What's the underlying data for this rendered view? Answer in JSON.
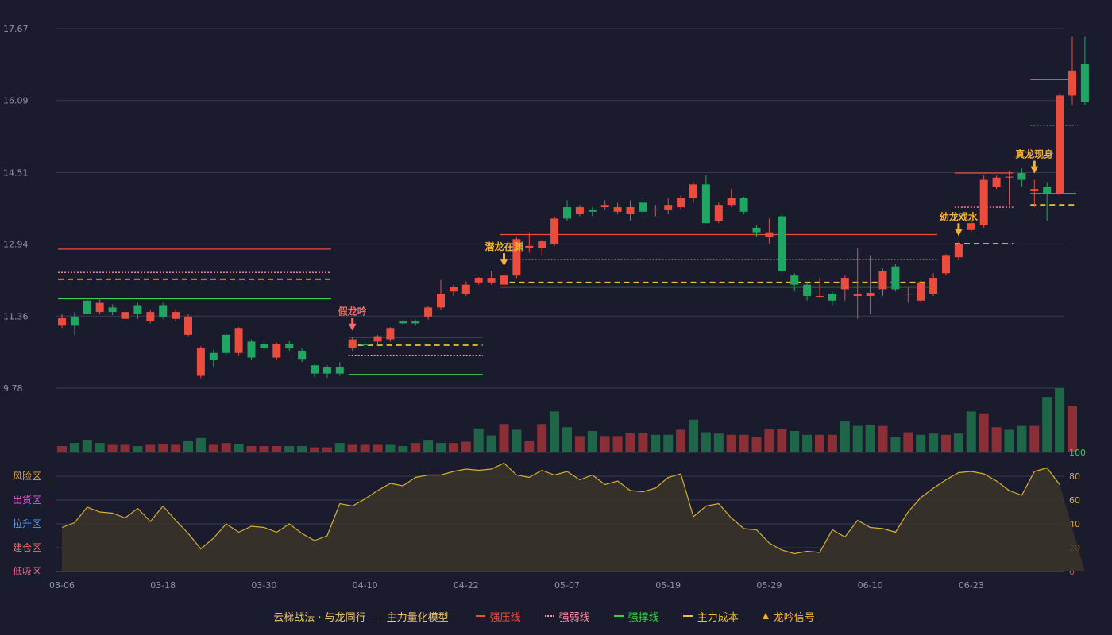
{
  "chart_data": {
    "type": "candlestick",
    "title": "云梯战法 · 与龙同行——主力量化模型",
    "price_axis": {
      "ticks": [
        9.78,
        11.36,
        12.94,
        14.51,
        16.09,
        17.67
      ],
      "range": [
        9.78,
        17.67
      ]
    },
    "date_labels": [
      {
        "i": 0,
        "label": "03-06"
      },
      {
        "i": 8,
        "label": "03-18"
      },
      {
        "i": 16,
        "label": "03-30"
      },
      {
        "i": 24,
        "label": "04-10"
      },
      {
        "i": 32,
        "label": "04-22"
      },
      {
        "i": 40,
        "label": "05-07"
      },
      {
        "i": 48,
        "label": "05-19"
      },
      {
        "i": 56,
        "label": "05-29"
      },
      {
        "i": 64,
        "label": "06-10"
      },
      {
        "i": 72,
        "label": "06-23"
      }
    ],
    "candles": [
      [
        11.15,
        11.32,
        11.4,
        11.1
      ],
      [
        11.35,
        11.15,
        11.45,
        10.95
      ],
      [
        11.7,
        11.4,
        11.72,
        11.4
      ],
      [
        11.45,
        11.65,
        11.75,
        11.4
      ],
      [
        11.55,
        11.45,
        11.62,
        11.38
      ],
      [
        11.3,
        11.45,
        11.55,
        11.25
      ],
      [
        11.6,
        11.4,
        11.65,
        11.3
      ],
      [
        11.25,
        11.45,
        11.5,
        11.2
      ],
      [
        11.6,
        11.35,
        11.65,
        11.3
      ],
      [
        11.3,
        11.45,
        11.52,
        11.25
      ],
      [
        10.95,
        11.35,
        11.4,
        10.92
      ],
      [
        10.05,
        10.65,
        10.7,
        10.0
      ],
      [
        10.55,
        10.4,
        10.62,
        10.25
      ],
      [
        10.95,
        10.55,
        10.98,
        10.5
      ],
      [
        10.55,
        11.1,
        11.12,
        10.5
      ],
      [
        10.8,
        10.45,
        10.85,
        10.4
      ],
      [
        10.75,
        10.65,
        10.8,
        10.6
      ],
      [
        10.45,
        10.75,
        10.78,
        10.4
      ],
      [
        10.75,
        10.65,
        10.82,
        10.6
      ],
      [
        10.6,
        10.42,
        10.65,
        10.35
      ],
      [
        10.28,
        10.1,
        10.32,
        10.02
      ],
      [
        10.25,
        10.1,
        10.28,
        10.0
      ],
      [
        10.25,
        10.1,
        10.35,
        10.05
      ],
      [
        10.65,
        10.85,
        10.9,
        10.6
      ],
      [
        10.75,
        10.72,
        10.78,
        10.65
      ],
      [
        10.8,
        10.92,
        10.95,
        10.72
      ],
      [
        10.85,
        11.1,
        11.12,
        10.8
      ],
      [
        11.25,
        11.2,
        11.3,
        11.15
      ],
      [
        11.25,
        11.2,
        11.28,
        11.15
      ],
      [
        11.35,
        11.55,
        11.58,
        11.28
      ],
      [
        11.55,
        11.85,
        12.15,
        11.5
      ],
      [
        11.9,
        12.0,
        12.05,
        11.8
      ],
      [
        11.85,
        12.05,
        12.12,
        11.8
      ],
      [
        12.1,
        12.2,
        12.22,
        12.05
      ],
      [
        12.1,
        12.2,
        12.35,
        12.05
      ],
      [
        12.05,
        12.25,
        12.32,
        12.0
      ],
      [
        12.25,
        13.05,
        13.1,
        12.2
      ],
      [
        12.85,
        12.9,
        13.2,
        12.75
      ],
      [
        12.85,
        13.0,
        13.05,
        12.7
      ],
      [
        12.95,
        13.5,
        13.55,
        12.9
      ],
      [
        13.75,
        13.5,
        13.9,
        13.45
      ],
      [
        13.6,
        13.75,
        13.8,
        13.55
      ],
      [
        13.7,
        13.65,
        13.75,
        13.55
      ],
      [
        13.75,
        13.8,
        13.9,
        13.7
      ],
      [
        13.65,
        13.75,
        13.85,
        13.6
      ],
      [
        13.6,
        13.75,
        13.9,
        13.45
      ],
      [
        13.85,
        13.65,
        13.95,
        13.55
      ],
      [
        13.7,
        13.7,
        13.8,
        13.55
      ],
      [
        13.7,
        13.8,
        13.95,
        13.6
      ],
      [
        13.75,
        13.95,
        14.0,
        13.7
      ],
      [
        13.95,
        14.25,
        14.3,
        13.85
      ],
      [
        14.25,
        13.4,
        14.45,
        13.4
      ],
      [
        13.45,
        13.8,
        13.85,
        13.4
      ],
      [
        13.8,
        13.95,
        14.15,
        13.75
      ],
      [
        13.95,
        13.65,
        13.98,
        13.6
      ],
      [
        13.3,
        13.2,
        13.35,
        13.1
      ],
      [
        13.1,
        13.2,
        13.5,
        12.95
      ],
      [
        13.55,
        12.35,
        13.6,
        12.3
      ],
      [
        12.25,
        12.05,
        12.3,
        11.9
      ],
      [
        12.05,
        11.8,
        12.1,
        11.7
      ],
      [
        11.8,
        11.8,
        12.2,
        11.75
      ],
      [
        11.85,
        11.7,
        11.9,
        11.6
      ],
      [
        11.95,
        12.2,
        12.25,
        11.7
      ],
      [
        11.8,
        11.85,
        12.85,
        11.3
      ],
      [
        11.8,
        11.87,
        12.7,
        11.4
      ],
      [
        11.95,
        12.35,
        12.4,
        11.8
      ],
      [
        12.45,
        11.95,
        12.5,
        11.9
      ],
      [
        11.85,
        11.85,
        12.0,
        11.65
      ],
      [
        11.7,
        12.1,
        12.15,
        11.65
      ],
      [
        11.85,
        12.2,
        12.3,
        11.8
      ],
      [
        12.3,
        12.7,
        12.72,
        12.25
      ],
      [
        12.65,
        12.95,
        12.98,
        12.6
      ],
      [
        13.25,
        13.4,
        13.45,
        13.2
      ],
      [
        13.35,
        14.35,
        14.45,
        13.3
      ],
      [
        14.2,
        14.4,
        14.45,
        14.15
      ],
      [
        14.4,
        14.42,
        14.55,
        13.8
      ],
      [
        14.5,
        14.35,
        14.6,
        14.2
      ],
      [
        14.1,
        14.15,
        14.35,
        13.75
      ],
      [
        14.2,
        14.05,
        14.3,
        13.45
      ],
      [
        14.05,
        16.2,
        16.25,
        14.0
      ],
      [
        16.2,
        16.75,
        17.5,
        16.0
      ],
      [
        16.9,
        16.05,
        17.5,
        16.0
      ]
    ],
    "volume": [
      1,
      1.5,
      2,
      1.5,
      1.2,
      1.2,
      1,
      1.2,
      1.3,
      1.2,
      1.8,
      2.3,
      1.2,
      1.5,
      1.3,
      1,
      1,
      1,
      1,
      1,
      0.8,
      0.8,
      1.5,
      1.2,
      1.2,
      1.2,
      1.2,
      1,
      1.5,
      2,
      1.5,
      1.5,
      1.7,
      3.8,
      2.7,
      4.5,
      3.6,
      1.8,
      4.5,
      6.5,
      4,
      2.6,
      3.4,
      2.6,
      2.6,
      3.1,
      3.1,
      2.8,
      2.8,
      3.6,
      5.2,
      3.2,
      3,
      2.8,
      2.8,
      2.5,
      3.7,
      3.7,
      3.4,
      2.8,
      2.8,
      2.8,
      4.9,
      4.2,
      4.4,
      4.2,
      2.4,
      3.2,
      2.8,
      3.0,
      2.8,
      3.0,
      6.5,
      6.2,
      4.0,
      3.6,
      4.2,
      4.2,
      8.8,
      10.2,
      7.4
    ],
    "volume_up": [
      1,
      0,
      0,
      0,
      1,
      1,
      0,
      1,
      1,
      1,
      0,
      0,
      1,
      1,
      0,
      1,
      1,
      1,
      0,
      0,
      1,
      1,
      0,
      1,
      1,
      1,
      0,
      0,
      1,
      0,
      0,
      1,
      1,
      0,
      0,
      1,
      0,
      1,
      1,
      0,
      0,
      1,
      0,
      1,
      1,
      1,
      1,
      0,
      0,
      1,
      0,
      0,
      0,
      1,
      1,
      1,
      1,
      1,
      0,
      0,
      1,
      1,
      0,
      0,
      0,
      1,
      0,
      1,
      0,
      0,
      1,
      0,
      0,
      1,
      1,
      0,
      0,
      1,
      0,
      0,
      1
    ],
    "indicator": {
      "axis_ticks_right": [
        0,
        20,
        40,
        60,
        80,
        100
      ],
      "zones": [
        {
          "label": "风险区",
          "color": "#e8a23a"
        },
        {
          "label": "出货区",
          "color": "#e25de0"
        },
        {
          "label": "拉升区",
          "color": "#5a9cf0"
        },
        {
          "label": "建仓区",
          "color": "#f06e6e"
        },
        {
          "label": "低吸区",
          "color": "#e36a8a"
        }
      ],
      "values": [
        37,
        41,
        54,
        50,
        49,
        45,
        53,
        42,
        55,
        43,
        32,
        19,
        28,
        40,
        33,
        38,
        37,
        33,
        40,
        32,
        26,
        30,
        57,
        55,
        61,
        68,
        74,
        72,
        79,
        81,
        81,
        84,
        86,
        85,
        86,
        91,
        81,
        79,
        85,
        81,
        84,
        77,
        81,
        73,
        76,
        68,
        67,
        70,
        79,
        82,
        46,
        55,
        57,
        45,
        36,
        35,
        24,
        18,
        15,
        17,
        16,
        35,
        29,
        43,
        37,
        36,
        33,
        50,
        62,
        70,
        77,
        83,
        84,
        82,
        76,
        68,
        64,
        84,
        87,
        73
      ]
    },
    "signals": [
      {
        "i": 23,
        "label": "假龙吟",
        "color": "#f06e6e"
      },
      {
        "i": 35,
        "label": "潜龙在渊",
        "color": "#f2b233"
      },
      {
        "i": 71,
        "label": "幼龙戏水",
        "color": "#f2b233"
      },
      {
        "i": 77,
        "label": "真龙现身",
        "color": "#f2b233"
      }
    ],
    "levels": [
      {
        "from": 0,
        "to": 21,
        "value": 12.83,
        "kind": "pressure"
      },
      {
        "from": 0,
        "to": 21,
        "value": 12.32,
        "kind": "weak"
      },
      {
        "from": 0,
        "to": 21,
        "value": 12.17,
        "kind": "cost"
      },
      {
        "from": 0,
        "to": 21,
        "value": 11.74,
        "kind": "support"
      },
      {
        "from": 23,
        "to": 33,
        "value": 10.9,
        "kind": "pressure"
      },
      {
        "from": 23,
        "to": 33,
        "value": 10.72,
        "kind": "cost"
      },
      {
        "from": 23,
        "to": 33,
        "value": 10.5,
        "kind": "weak"
      },
      {
        "from": 23,
        "to": 33,
        "value": 10.08,
        "kind": "support"
      },
      {
        "from": 35,
        "to": 69,
        "value": 13.15,
        "kind": "pressure"
      },
      {
        "from": 35,
        "to": 69,
        "value": 12.6,
        "kind": "weak"
      },
      {
        "from": 35,
        "to": 69,
        "value": 12.1,
        "kind": "cost"
      },
      {
        "from": 35,
        "to": 69,
        "value": 12.0,
        "kind": "support"
      },
      {
        "from": 71,
        "to": 75,
        "value": 14.5,
        "kind": "pressure"
      },
      {
        "from": 71,
        "to": 75,
        "value": 13.75,
        "kind": "weak"
      },
      {
        "from": 71,
        "to": 75,
        "value": 12.95,
        "kind": "cost"
      },
      {
        "from": 77,
        "to": 80,
        "value": 16.55,
        "kind": "pressure"
      },
      {
        "from": 77,
        "to": 80,
        "value": 15.55,
        "kind": "weak"
      },
      {
        "from": 77,
        "to": 80,
        "value": 14.05,
        "kind": "support"
      },
      {
        "from": 77,
        "to": 80,
        "value": 13.8,
        "kind": "cost"
      }
    ],
    "colors": {
      "up": "#ea4d3d",
      "down": "#1fa663",
      "pressure": "#ea4d3d",
      "weak": "#ff8fa3",
      "support": "#3ecf4a",
      "cost": "#f2c12e",
      "indicator_line": "#d8b02a",
      "grid": "#3a3a52",
      "axis_text": "#8f93a6"
    }
  },
  "legend": {
    "title": "云梯战法 · 与龙同行——主力量化模型",
    "items": [
      {
        "label": "强压线",
        "color": "#ea4d3d",
        "style": "solid"
      },
      {
        "label": "强弱线",
        "color": "#ff8fa3",
        "style": "dotted"
      },
      {
        "label": "强撑线",
        "color": "#3ecf4a",
        "style": "solid"
      },
      {
        "label": "主力成本",
        "color": "#f2c12e",
        "style": "dashed"
      },
      {
        "label": "龙吟信号",
        "color": "#f2b233",
        "style": "triangle"
      }
    ]
  }
}
